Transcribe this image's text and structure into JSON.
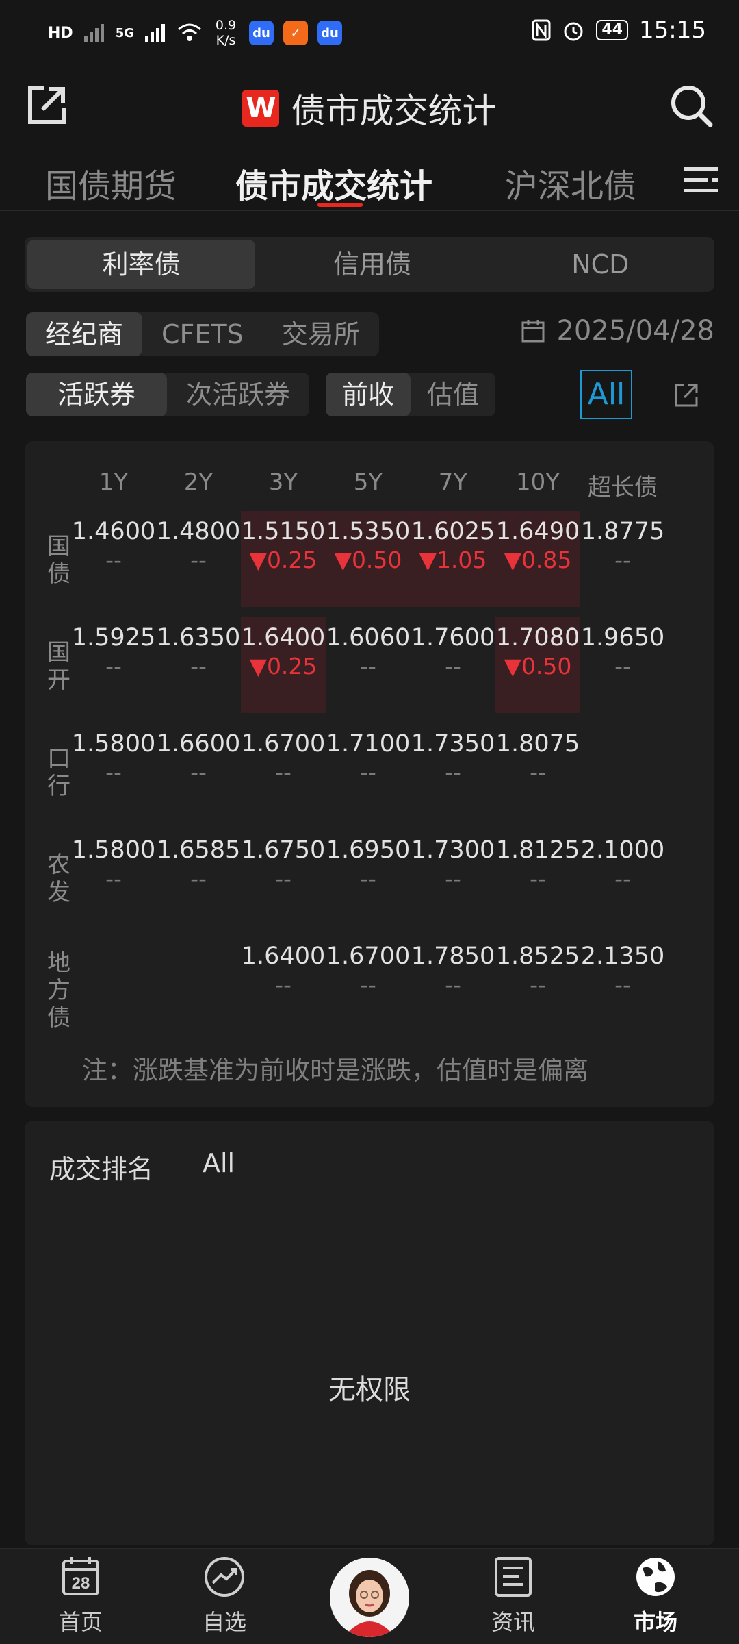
{
  "status_bar": {
    "hd": "HD",
    "net5g": "5G",
    "speed_value": "0.9",
    "speed_unit": "K/s",
    "battery": "44",
    "time": "15:15"
  },
  "header": {
    "logo_letter": "W",
    "title": "债市成交统计"
  },
  "tabs": [
    {
      "label": "国债期货"
    },
    {
      "label": "债市成交统计"
    },
    {
      "label": "沪深北债"
    }
  ],
  "bond_type_segment": [
    "利率债",
    "信用债",
    "NCD"
  ],
  "source_segment": [
    "经纪商",
    "CFETS",
    "交易所"
  ],
  "date": "2025/04/28",
  "activity_segment": [
    "活跃券",
    "次活跃券"
  ],
  "basis_segment": [
    "前收",
    "估值"
  ],
  "all_filter": "All",
  "table": {
    "columns": [
      "1Y",
      "2Y",
      "3Y",
      "5Y",
      "7Y",
      "10Y",
      "超长债"
    ],
    "rows": [
      {
        "label": "国\n债",
        "cells": [
          {
            "v": "1.4600",
            "d": "--"
          },
          {
            "v": "1.4800",
            "d": "--"
          },
          {
            "v": "1.5150",
            "d": "▼0.25"
          },
          {
            "v": "1.5350",
            "d": "▼0.50"
          },
          {
            "v": "1.6025",
            "d": "▼1.05"
          },
          {
            "v": "1.6490",
            "d": "▼0.85"
          },
          {
            "v": "1.8775",
            "d": "--"
          }
        ]
      },
      {
        "label": "国\n开",
        "cells": [
          {
            "v": "1.5925",
            "d": "--"
          },
          {
            "v": "1.6350",
            "d": "--"
          },
          {
            "v": "1.6400",
            "d": "▼0.25"
          },
          {
            "v": "1.6060",
            "d": "--"
          },
          {
            "v": "1.7600",
            "d": "--"
          },
          {
            "v": "1.7080",
            "d": "▼0.50"
          },
          {
            "v": "1.9650",
            "d": "--"
          }
        ]
      },
      {
        "label": "口\n行",
        "cells": [
          {
            "v": "1.5800",
            "d": "--"
          },
          {
            "v": "1.6600",
            "d": "--"
          },
          {
            "v": "1.6700",
            "d": "--"
          },
          {
            "v": "1.7100",
            "d": "--"
          },
          {
            "v": "1.7350",
            "d": "--"
          },
          {
            "v": "1.8075",
            "d": "--"
          },
          {
            "v": "",
            "d": ""
          }
        ]
      },
      {
        "label": "农\n发",
        "cells": [
          {
            "v": "1.5800",
            "d": "--"
          },
          {
            "v": "1.6585",
            "d": "--"
          },
          {
            "v": "1.6750",
            "d": "--"
          },
          {
            "v": "1.6950",
            "d": "--"
          },
          {
            "v": "1.7300",
            "d": "--"
          },
          {
            "v": "1.8125",
            "d": "--"
          },
          {
            "v": "2.1000",
            "d": "--"
          }
        ]
      },
      {
        "label": "地\n方\n债",
        "cells": [
          {
            "v": "",
            "d": ""
          },
          {
            "v": "",
            "d": ""
          },
          {
            "v": "1.6400",
            "d": "--"
          },
          {
            "v": "1.6700",
            "d": "--"
          },
          {
            "v": "1.7850",
            "d": "--"
          },
          {
            "v": "1.8525",
            "d": "--"
          },
          {
            "v": "2.1350",
            "d": "--"
          }
        ]
      }
    ],
    "note": "注：涨跌基准为前收时是涨跌，估值时是偏离"
  },
  "ranking": {
    "title": "成交排名",
    "filter": "All",
    "no_permission": "无权限"
  },
  "bottom_nav": [
    {
      "label": "首页",
      "icon": "calendar-icon",
      "calendar_day": "28"
    },
    {
      "label": "自选",
      "icon": "trend-icon"
    },
    {
      "label": "资讯",
      "icon": "news-icon"
    },
    {
      "label": "市场",
      "icon": "globe-icon"
    }
  ],
  "colors": {
    "accent": "#e8271e",
    "down": "#e8333a",
    "highlight": "#3a1f22",
    "all_border": "#1d9ad6"
  }
}
